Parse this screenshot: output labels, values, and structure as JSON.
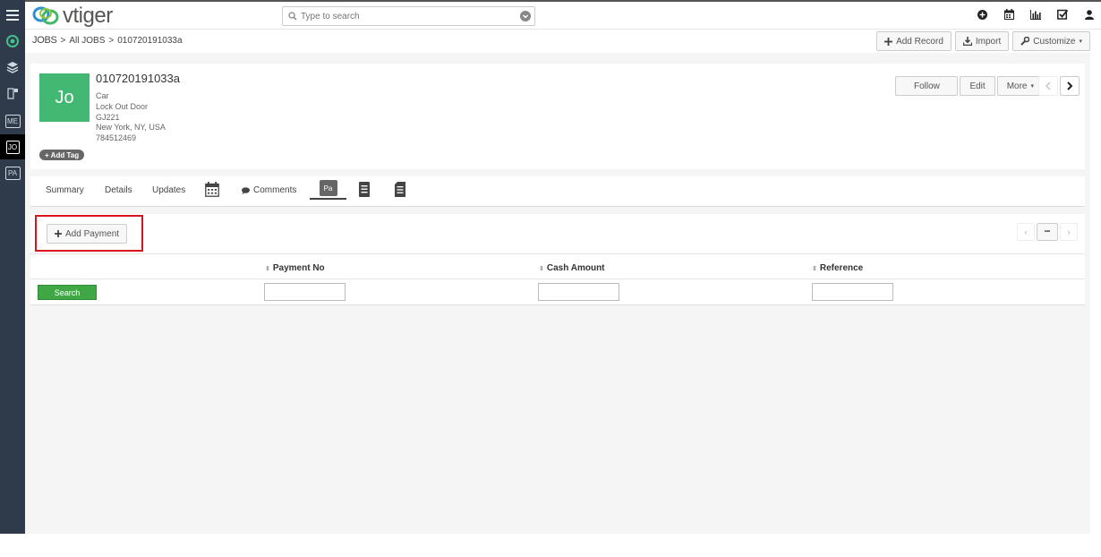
{
  "app": {
    "logo_text": "vtiger",
    "search_placeholder": "Type to search"
  },
  "sidebar": {
    "items": [
      {
        "label": "ME"
      },
      {
        "label": "JO"
      },
      {
        "label": "PA"
      }
    ]
  },
  "breadcrumb": {
    "module": "JOBS",
    "list": "All JOBS",
    "record": "010720191033a"
  },
  "header_buttons": {
    "add_record": "Add Record",
    "import": "Import",
    "customize": "Customize"
  },
  "record": {
    "avatar": "Jo",
    "title": "010720191033a",
    "lines": [
      "Car",
      "Lock Out Door",
      "GJ221",
      "New York, NY, USA",
      "784512469"
    ],
    "add_tag": "Add Tag",
    "follow": "Follow",
    "edit": "Edit",
    "more": "More"
  },
  "tabs": {
    "summary": "Summary",
    "details": "Details",
    "updates": "Updates",
    "comments": "Comments",
    "payments_badge": "Pa"
  },
  "related": {
    "add_payment": "Add Payment",
    "pager_mid": "•••",
    "columns": [
      "Payment No",
      "Cash Amount",
      "Reference"
    ],
    "search_label": "Search"
  }
}
